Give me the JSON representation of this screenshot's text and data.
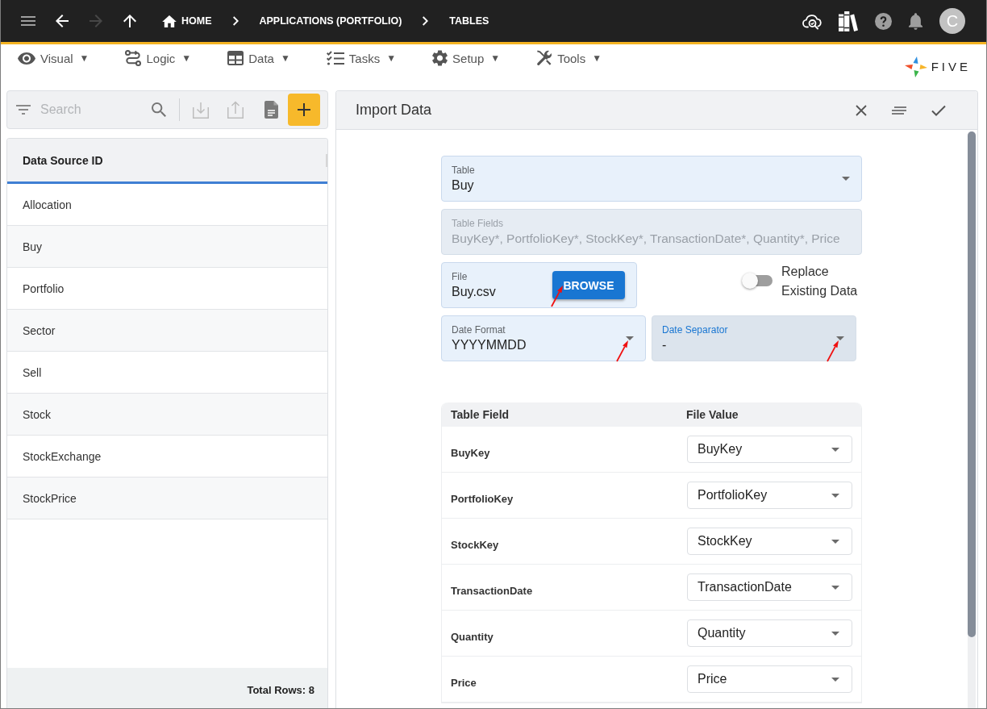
{
  "top_bar": {
    "nav_buttons": [
      {
        "kind": "menu",
        "disabled": false
      },
      {
        "kind": "back",
        "disabled": false
      },
      {
        "kind": "forward",
        "disabled": true
      },
      {
        "kind": "up",
        "disabled": false
      }
    ],
    "breadcrumbs": [
      {
        "kind": "home",
        "label": "HOME"
      },
      {
        "kind": "page",
        "label": "APPLICATIONS (PORTFOLIO)"
      },
      {
        "kind": "page",
        "label": "TABLES"
      }
    ],
    "avatar": {
      "initial": "C"
    }
  },
  "menu_bar": {
    "items": [
      {
        "kind": "visual",
        "label": "Visual",
        "caret": "▼"
      },
      {
        "kind": "logic",
        "label": "Logic",
        "caret": "▼"
      },
      {
        "kind": "data",
        "label": "Data",
        "caret": "▼"
      },
      {
        "kind": "tasks",
        "label": "Tasks",
        "caret": "▼"
      },
      {
        "kind": "setup",
        "label": "Setup",
        "caret": "▼"
      },
      {
        "kind": "tools",
        "label": "Tools",
        "caret": "▼"
      }
    ],
    "logo": {
      "text": "FIVE"
    }
  },
  "left_panel": {
    "search": {
      "placeholder": "Search"
    },
    "list": {
      "column": "Data Source ID",
      "rows": [
        "Allocation",
        "Buy",
        "Portfolio",
        "Sector",
        "Sell",
        "Stock",
        "StockExchange",
        "StockPrice"
      ]
    },
    "footer": "Total Rows: 8"
  },
  "import_panel": {
    "title": "Import Data",
    "rows": [
      {
        "fields": [
          {
            "kind": "select",
            "label": "Table",
            "value": "Buy",
            "disabled": false,
            "focused": false,
            "annotated": false
          }
        ]
      },
      {
        "fields": [
          {
            "kind": "text",
            "label": "Table Fields",
            "value": "BuyKey*, PortfolioKey*, StockKey*, TransactionDate*, Quantity*, Price",
            "disabled": true,
            "focused": false,
            "annotated": false
          }
        ]
      },
      {
        "fields": [
          {
            "kind": "file",
            "label": "File",
            "value": "Buy.csv",
            "button": "BROWSE",
            "disabled": false,
            "focused": false,
            "annotated": true
          },
          {
            "kind": "toggle",
            "label": "Replace Existing Data",
            "on": false
          }
        ]
      },
      {
        "fields": [
          {
            "kind": "select",
            "label": "Date Format",
            "value": "YYYYMMDD",
            "disabled": false,
            "focused": false,
            "annotated": true
          },
          {
            "kind": "select",
            "label": "Date Separator",
            "value": "-",
            "disabled": false,
            "focused": true,
            "annotated": true
          }
        ]
      }
    ],
    "mapping": {
      "columns": [
        "Table Field",
        "File Value"
      ],
      "rows": [
        {
          "field": "BuyKey",
          "value": "BuyKey"
        },
        {
          "field": "PortfolioKey",
          "value": "PortfolioKey"
        },
        {
          "field": "StockKey",
          "value": "StockKey"
        },
        {
          "field": "TransactionDate",
          "value": "TransactionDate"
        },
        {
          "field": "Quantity",
          "value": "Quantity"
        },
        {
          "field": "Price",
          "value": "Price"
        }
      ]
    }
  }
}
